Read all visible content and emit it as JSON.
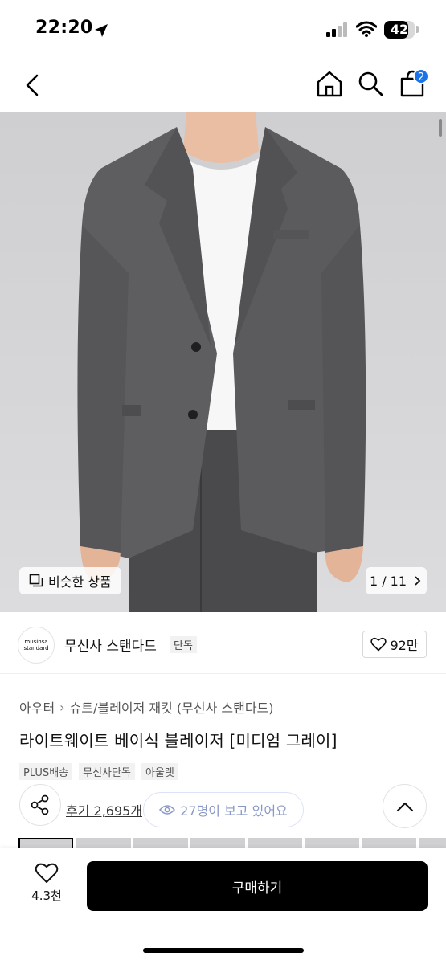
{
  "status_bar": {
    "time": "22:20",
    "battery": "42"
  },
  "nav": {
    "cart_count": "2"
  },
  "hero": {
    "similar_label": "비슷한 상품",
    "page_indicator": "1 / 11"
  },
  "brand": {
    "logo_line1": "musinsa",
    "logo_line2": "standard",
    "name": "무신사 스탠다드",
    "tag": "단독",
    "likes": "92만"
  },
  "product": {
    "breadcrumb": [
      "아우터",
      "슈트/블레이저 재킷 (무신사 스탠다드)"
    ],
    "title": "라이트웨이트 베이식 블레이저 [미디엄 그레이]",
    "tags": [
      "PLUS배송",
      "무신사단독",
      "아울렛"
    ],
    "reviews": "후기 2,695개",
    "viewers": "27명이 보고 있어요"
  },
  "bottom_bar": {
    "wishlist_count": "4.3천",
    "buy_label": "구매하기"
  },
  "colors": {
    "buy_button": "#000000",
    "badge": "#1a73e8",
    "viewers_text": "#8a98c8"
  }
}
